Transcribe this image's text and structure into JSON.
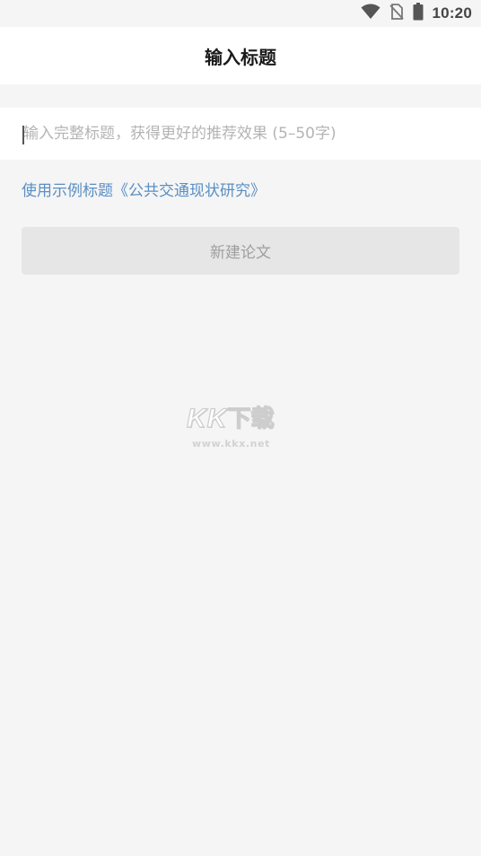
{
  "status_bar": {
    "time": "10:20",
    "icons": [
      "wifi-icon",
      "no-sim-icon",
      "battery-icon"
    ]
  },
  "header": {
    "title": "输入标题"
  },
  "form": {
    "title_input": {
      "value": "",
      "placeholder": "输入完整标题，获得更好的推荐效果 (5–50字)"
    },
    "example_link": "使用示例标题《公共交通现状研究》",
    "create_button": "新建论文"
  },
  "watermark": {
    "logo_letters": [
      "K",
      "K"
    ],
    "logo_text": "下载",
    "url": "www.kkx.net"
  },
  "colors": {
    "background": "#f5f5f5",
    "surface": "#ffffff",
    "link": "#5a8fc4",
    "button_disabled_bg": "#e6e6e6",
    "button_disabled_text": "#9e9e9e",
    "placeholder": "#b4b4b4"
  }
}
